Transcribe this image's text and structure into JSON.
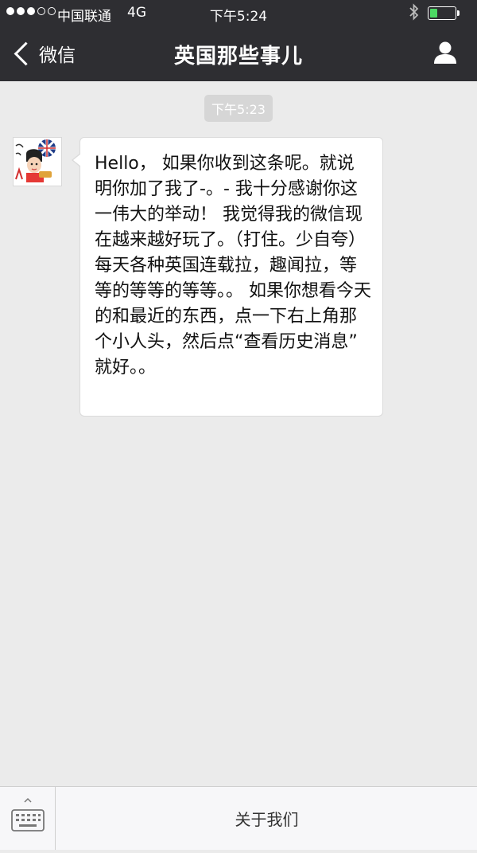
{
  "status_bar": {
    "carrier": "中国联通",
    "network": "4G",
    "time": "下午5:24",
    "battery_level": 0.3,
    "battery_color": "#4cd964"
  },
  "nav": {
    "back_label": "微信",
    "title": "英国那些事儿",
    "profile_icon": "person-icon"
  },
  "chat": {
    "timestamp": "下午5:23",
    "avatar_icon": "official-account-avatar",
    "message": "Hello， 如果你收到这条呢。就说明你加了我了-。- 我十分感谢你这一伟大的举动！ 我觉得我的微信现在越来越好玩了。（打住。少自夸） 每天各种英国连载拉，趣闻拉，等等的等等的等等。。 如果你想看今天的和最近的东西，点一下右上角那个小人头，然后点“查看历史消息” 就好。。"
  },
  "bottom_bar": {
    "keyboard_icon": "keyboard-icon",
    "menu_label": "关于我们"
  },
  "colors": {
    "nav_background": "#2e2e32",
    "chat_background": "#ebebeb",
    "bubble_background": "#ffffff"
  }
}
